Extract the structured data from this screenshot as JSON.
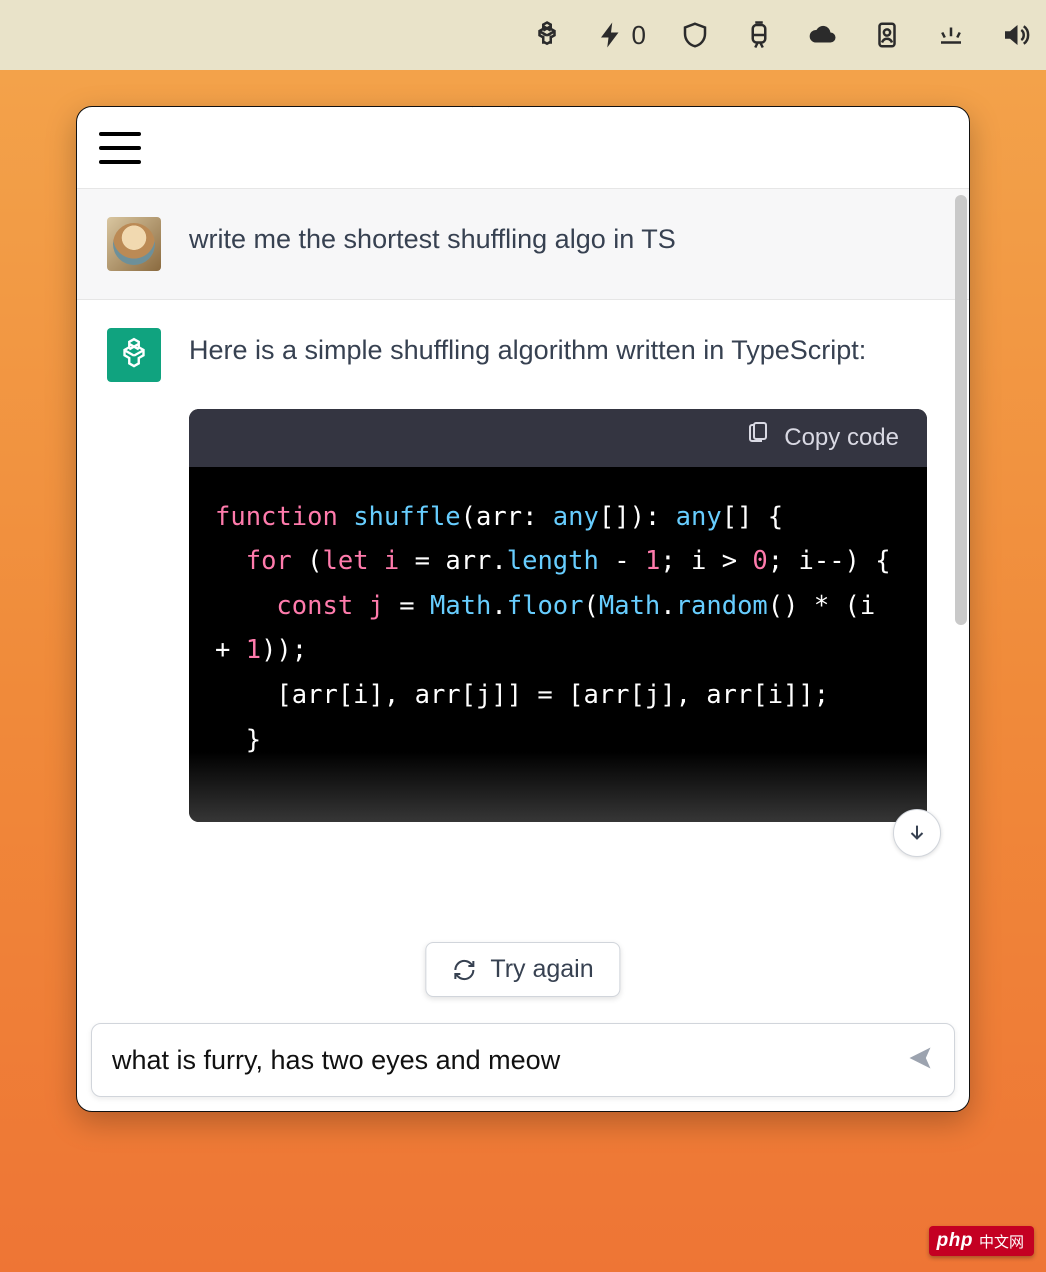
{
  "menubar": {
    "bolt_count": "0"
  },
  "chat": {
    "user_message": "write me the shortest shuffling algo in TS",
    "assistant_intro": "Here is a simple shuffling algorithm written in TypeScript:",
    "code": {
      "copy_label": "Copy code",
      "tokens": {
        "kw_function": "function",
        "fn_name": "shuffle",
        "param": "arr",
        "type_any1": "any",
        "type_any2": "any",
        "kw_for": "for",
        "kw_let": "let",
        "var_i": "i",
        "prop_length": "length",
        "num_1a": "1",
        "num_0": "0",
        "kw_const": "const",
        "var_j": "j",
        "obj_math1": "Math",
        "fn_floor": "floor",
        "obj_math2": "Math",
        "fn_random": "random",
        "num_1b": "1"
      }
    },
    "try_again_label": "Try again"
  },
  "composer": {
    "value": "what is furry, has two eyes and meow"
  },
  "watermark": {
    "brand": "php",
    "cn": "中文网"
  }
}
